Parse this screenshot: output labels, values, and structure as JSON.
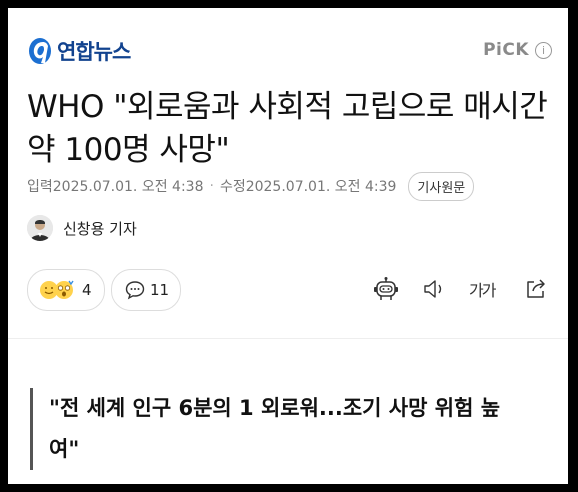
{
  "header": {
    "logo_text": "연합뉴스",
    "pick_label": "PiCK",
    "pick_info_glyph": "i"
  },
  "article": {
    "title": "WHO \"외로움과 사회적 고립으로 매시간 약 100명 사망\"",
    "input_label": "입력",
    "input_date": "2025.07.01. 오전 4:38",
    "modified_label": "수정",
    "modified_date": "2025.07.01. 오전 4:39",
    "original_button": "기사원문",
    "reporter": "신창용 기자",
    "quote": "\"전 세계 인구 6분의 1 외로워...조기 사망 위험 높여\""
  },
  "actions": {
    "reaction_count": "4",
    "comment_count": "11",
    "font_size_label": "가가"
  },
  "colors": {
    "brand": "#12438f",
    "text": "#111111",
    "muted": "#777777"
  }
}
